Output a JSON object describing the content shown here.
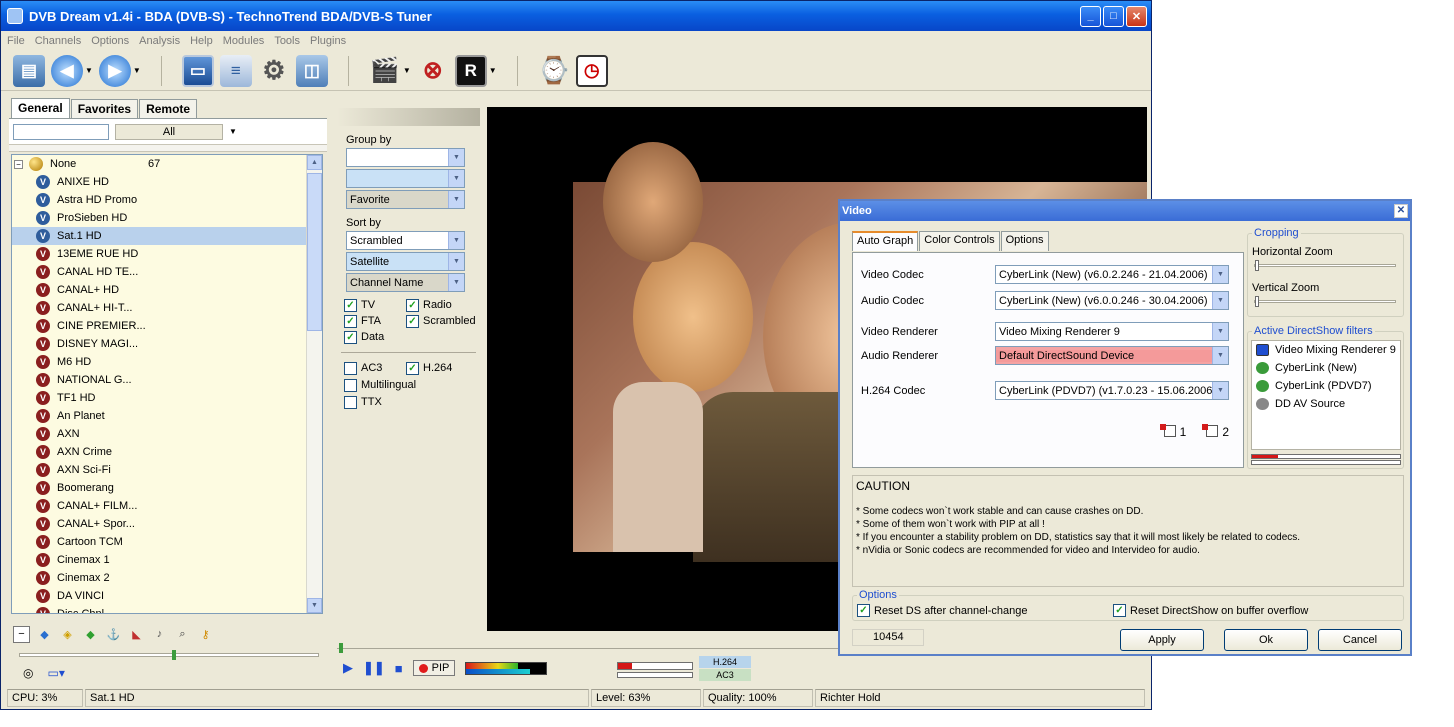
{
  "app": {
    "title": "DVB Dream v1.4i - BDA (DVB-S)  -  TechnoTrend BDA/DVB-S Tuner",
    "window_buttons": {
      "minimize": "_",
      "maximize": "□",
      "close": "✕"
    }
  },
  "menu": [
    "File",
    "Channels",
    "Options",
    "Analysis",
    "Help",
    "Modules",
    "Tools",
    "Plugins"
  ],
  "toolbar_icons": [
    "open-folder-icon",
    "back-icon",
    "forward-icon",
    "monitor-icon",
    "epg-icon",
    "settings-gears-icon",
    "screenshot-icon",
    "recorder-icon",
    "stop-icon",
    "osd-icon",
    "timer-icon",
    "scheduler-icon"
  ],
  "left": {
    "tabs": [
      "General",
      "Favorites",
      "Remote"
    ],
    "filter_all": "All",
    "root": {
      "label": "None",
      "count": "67"
    },
    "channels": [
      {
        "name": "ANIXE HD",
        "type": "blue"
      },
      {
        "name": "Astra HD Promo",
        "type": "blue"
      },
      {
        "name": "ProSieben HD",
        "type": "blue"
      },
      {
        "name": "Sat.1 HD",
        "type": "blue",
        "selected": true
      },
      {
        "name": "13EME RUE HD",
        "type": "red"
      },
      {
        "name": "CANAL HD TE...",
        "type": "red"
      },
      {
        "name": "CANAL+ HD",
        "type": "red"
      },
      {
        "name": "CANAL+ HI-T...",
        "type": "red"
      },
      {
        "name": "CINE PREMIER...",
        "type": "red"
      },
      {
        "name": "DISNEY MAGI...",
        "type": "red"
      },
      {
        "name": "M6 HD",
        "type": "red"
      },
      {
        "name": "NATIONAL G...",
        "type": "red"
      },
      {
        "name": "TF1 HD",
        "type": "red"
      },
      {
        "name": "An Planet",
        "type": "red"
      },
      {
        "name": "AXN",
        "type": "red"
      },
      {
        "name": "AXN Crime",
        "type": "red"
      },
      {
        "name": "AXN Sci-Fi",
        "type": "red"
      },
      {
        "name": "Boomerang",
        "type": "red"
      },
      {
        "name": "CANAL+ FILM...",
        "type": "red"
      },
      {
        "name": "CANAL+ Spor...",
        "type": "red"
      },
      {
        "name": "Cartoon TCM",
        "type": "red"
      },
      {
        "name": "Cinemax 1",
        "type": "red"
      },
      {
        "name": "Cinemax 2",
        "type": "red"
      },
      {
        "name": "DA VINCI",
        "type": "red"
      },
      {
        "name": "Disc.Chnl",
        "type": "red"
      }
    ],
    "channel_icon_letter": "V"
  },
  "filter": {
    "group_by_label": "Group by",
    "group_by_values": [
      "",
      "",
      "Favorite"
    ],
    "sort_by_label": "Sort by",
    "sort_by_values": [
      "Scrambled",
      "Satellite",
      "Channel Name"
    ],
    "checks": [
      {
        "label": "TV",
        "checked": true
      },
      {
        "label": "Radio",
        "checked": true
      },
      {
        "label": "FTA",
        "checked": true
      },
      {
        "label": "Scrambled",
        "checked": true
      },
      {
        "label": "Data",
        "checked": true
      }
    ],
    "checks2": [
      {
        "label": "AC3",
        "checked": false
      },
      {
        "label": "H.264",
        "checked": true
      }
    ],
    "checks3": [
      {
        "label": "Multilingual",
        "checked": false
      },
      {
        "label": "TTX",
        "checked": false
      }
    ]
  },
  "controls": {
    "pip_label": "PIP",
    "codec_video": "H.264",
    "codec_audio": "AC3"
  },
  "status": {
    "cpu": "CPU: 3%",
    "channel": "Sat.1 HD",
    "level": "Level: 63%",
    "quality": "Quality: 100%",
    "show": "Richter Hold"
  },
  "dialog": {
    "title": "Video",
    "tabs": [
      "Auto Graph",
      "Color Controls",
      "Options"
    ],
    "rows": [
      {
        "label": "Video Codec",
        "value": "CyberLink (New)   (v6.0.2.246 - 21.04.2006)"
      },
      {
        "label": "Audio Codec",
        "value": "CyberLink (New)   (v6.0.0.246 - 30.04.2006)"
      },
      {
        "label": "Video Renderer",
        "value": "Video Mixing Renderer 9"
      },
      {
        "label": "Audio Renderer",
        "value": "Default DirectSound Device"
      },
      {
        "label": "H.264 Codec",
        "value": "CyberLink (PDVD7)   (v1.7.0.23 - 15.06.2006)"
      }
    ],
    "copy_buttons": [
      "1",
      "2"
    ],
    "cropping": {
      "title": "Cropping",
      "h_zoom": "Horizontal Zoom",
      "v_zoom": "Vertical Zoom"
    },
    "active_filters": {
      "title": "Active DirectShow filters",
      "items": [
        "Video Mixing Renderer 9",
        "CyberLink (New)",
        "CyberLink (PDVD7)",
        "DD AV Source"
      ]
    },
    "caution": {
      "title": "CAUTION",
      "lines": [
        "*  Some codecs won`t work stable and can cause crashes on DD.",
        "*  Some of them won`t work with PIP at all !",
        "*  If you encounter a stability problem on DD, statistics say that it will most likely be related to codecs.",
        "*  nVidia or Sonic codecs are recommended for video and Intervideo for audio."
      ]
    },
    "options": {
      "title": "Options",
      "reset_ds": "Reset DS after channel-change",
      "reset_buffer": "Reset DirectShow on buffer overflow"
    },
    "counter": "10454",
    "buttons": {
      "apply": "Apply",
      "ok": "Ok",
      "cancel": "Cancel"
    }
  }
}
